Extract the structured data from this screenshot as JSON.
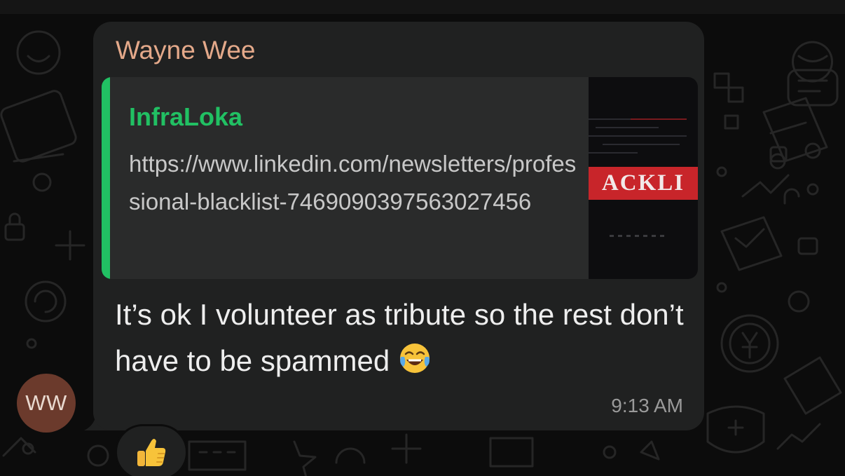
{
  "message": {
    "sender_name": "Wayne Wee",
    "avatar_initials": "WW",
    "link_preview": {
      "title": "InfraLoka",
      "url": "https://www.linkedin.com/newsletters/professional-blacklist-7469090397563027456",
      "thumbnail_text": "ACKLI"
    },
    "text": "It’s ok I volunteer as tribute so the rest don’t have to be spammed",
    "inline_emoji": "face-with-tears-of-joy",
    "timestamp": "9:13 AM",
    "reaction": "thumbs-up"
  },
  "colors": {
    "background": "#0c0c0c",
    "bubble": "#202121",
    "sender_name": "#e4a98a",
    "link_accent": "#21c063",
    "avatar": "#6b3a2c"
  }
}
